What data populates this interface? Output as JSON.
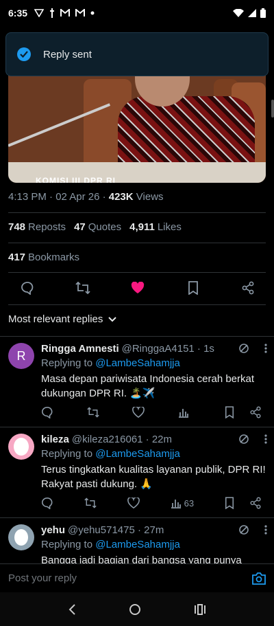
{
  "status_bar": {
    "time": "6:35"
  },
  "toast": {
    "text": "Reply sent"
  },
  "media": {
    "caption": "KOMISI III DPR RI"
  },
  "tweet": {
    "time_date": "4:13 PM · 02 Apr 26 ·",
    "views_count": "423K",
    "views_label": "Views",
    "reposts_count": "748",
    "reposts_label": "Reposts",
    "quotes_count": "47",
    "quotes_label": "Quotes",
    "likes_count": "4,911",
    "likes_label": "Likes",
    "bookmarks_count": "417",
    "bookmarks_label": "Bookmarks",
    "like_color": "#f91880"
  },
  "sort": {
    "label": "Most relevant replies"
  },
  "replies": [
    {
      "avatar_letter": "R",
      "avatar_color": "#8e44ad",
      "name": "Ringga Amnesti",
      "handle": "@RinggaA4151 · 1s",
      "replying_prefix": "Replying to",
      "replying_to": "@LambeSahamjja",
      "text": "Masa depan pariwisata Indonesia cerah berkat dukungan DPR RI. 🏝️✈️",
      "views": ""
    },
    {
      "avatar_letter": "",
      "avatar_color": "#f7a8c4",
      "name": "kileza",
      "handle": "@kileza216061 · 22m",
      "replying_prefix": "Replying to",
      "replying_to": "@LambeSahamjja",
      "text": "Terus tingkatkan kualitas layanan publik, DPR RI! Rakyat pasti dukung. 🙏",
      "views": "63"
    },
    {
      "avatar_letter": "",
      "avatar_color": "#8fa3b1",
      "name": "yehu",
      "handle": "@yehu571475 · 27m",
      "replying_prefix": "Replying to",
      "replying_to": "@LambeSahamjja",
      "text": "Bangga jadi bagian dari bangsa yang punya",
      "views": ""
    }
  ],
  "composer": {
    "placeholder": "Post your reply"
  },
  "colors": {
    "accent": "#1d9bf0",
    "background": "#000000",
    "muted": "#8b98a5"
  }
}
